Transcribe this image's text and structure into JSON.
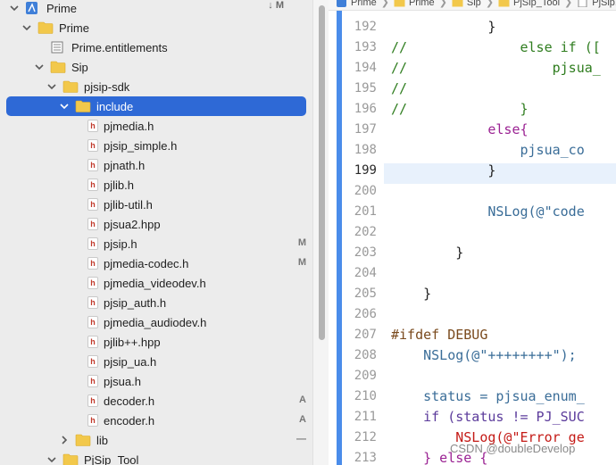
{
  "navigator": {
    "root": {
      "label": "Prime",
      "status": "↓ M"
    },
    "items": [
      {
        "label": "Prime",
        "kind": "folder"
      },
      {
        "label": "Prime.entitlements",
        "kind": "entitlements"
      },
      {
        "label": "Sip",
        "kind": "folder"
      },
      {
        "label": "pjsip-sdk",
        "kind": "folder"
      },
      {
        "label": "include",
        "kind": "folder",
        "selected": true
      },
      {
        "label": "pjmedia.h",
        "kind": "header"
      },
      {
        "label": "pjsip_simple.h",
        "kind": "header"
      },
      {
        "label": "pjnath.h",
        "kind": "header"
      },
      {
        "label": "pjlib.h",
        "kind": "header"
      },
      {
        "label": "pjlib-util.h",
        "kind": "header"
      },
      {
        "label": "pjsua2.hpp",
        "kind": "header"
      },
      {
        "label": "pjsip.h",
        "kind": "header",
        "badge": "M"
      },
      {
        "label": "pjmedia-codec.h",
        "kind": "header",
        "badge": "M"
      },
      {
        "label": "pjmedia_videodev.h",
        "kind": "header"
      },
      {
        "label": "pjsip_auth.h",
        "kind": "header"
      },
      {
        "label": "pjmedia_audiodev.h",
        "kind": "header"
      },
      {
        "label": "pjlib++.hpp",
        "kind": "header"
      },
      {
        "label": "pjsip_ua.h",
        "kind": "header"
      },
      {
        "label": "pjsua.h",
        "kind": "header"
      },
      {
        "label": "decoder.h",
        "kind": "header",
        "badge": "A"
      },
      {
        "label": "encoder.h",
        "kind": "header",
        "badge": "A"
      },
      {
        "label": "lib",
        "kind": "folder",
        "badge": "—"
      },
      {
        "label": "PjSip_Tool",
        "kind": "folder"
      }
    ],
    "header_glyph": "h"
  },
  "jumpbar": {
    "crumbs": [
      "Prime",
      "Prime",
      "Sip",
      "PjSip_Tool",
      "PjSip.m"
    ],
    "separator": "❯"
  },
  "editor": {
    "current_line": "199",
    "lines": [
      {
        "n": "192",
        "text": "            }"
      },
      {
        "n": "193",
        "text": "//              else if (["
      },
      {
        "n": "194",
        "text": "//                  pjsua_"
      },
      {
        "n": "195",
        "text": "//"
      },
      {
        "n": "196",
        "text": "//              }"
      },
      {
        "n": "197",
        "text": "            else{"
      },
      {
        "n": "198",
        "text": "                pjsua_co"
      },
      {
        "n": "199",
        "text": "            }"
      },
      {
        "n": "200",
        "text": ""
      },
      {
        "n": "201",
        "text": "            NSLog(@\"code"
      },
      {
        "n": "202",
        "text": ""
      },
      {
        "n": "203",
        "text": "        }"
      },
      {
        "n": "204",
        "text": ""
      },
      {
        "n": "205",
        "text": "    }"
      },
      {
        "n": "206",
        "text": ""
      },
      {
        "n": "207",
        "text": "#ifdef DEBUG"
      },
      {
        "n": "208",
        "text": "    NSLog(@\"++++++++\");"
      },
      {
        "n": "209",
        "text": ""
      },
      {
        "n": "210",
        "text": "    status = pjsua_enum_"
      },
      {
        "n": "211",
        "text": "    if (status != PJ_SUC"
      },
      {
        "n": "212",
        "text": "        NSLog(@\"Error ge"
      },
      {
        "n": "213",
        "text": "    } else {"
      }
    ]
  },
  "watermark": "CSDN @doubleDevelop",
  "colors": {
    "selection": "#2e69d6",
    "gutter_bar": "#4a8cea",
    "current_line": "#e8f1fc",
    "folder": "#f2c84b",
    "comment": "#2f7d1f",
    "keyword": "#9b2393",
    "function": "#3a6d98",
    "string": "#c41a16"
  }
}
